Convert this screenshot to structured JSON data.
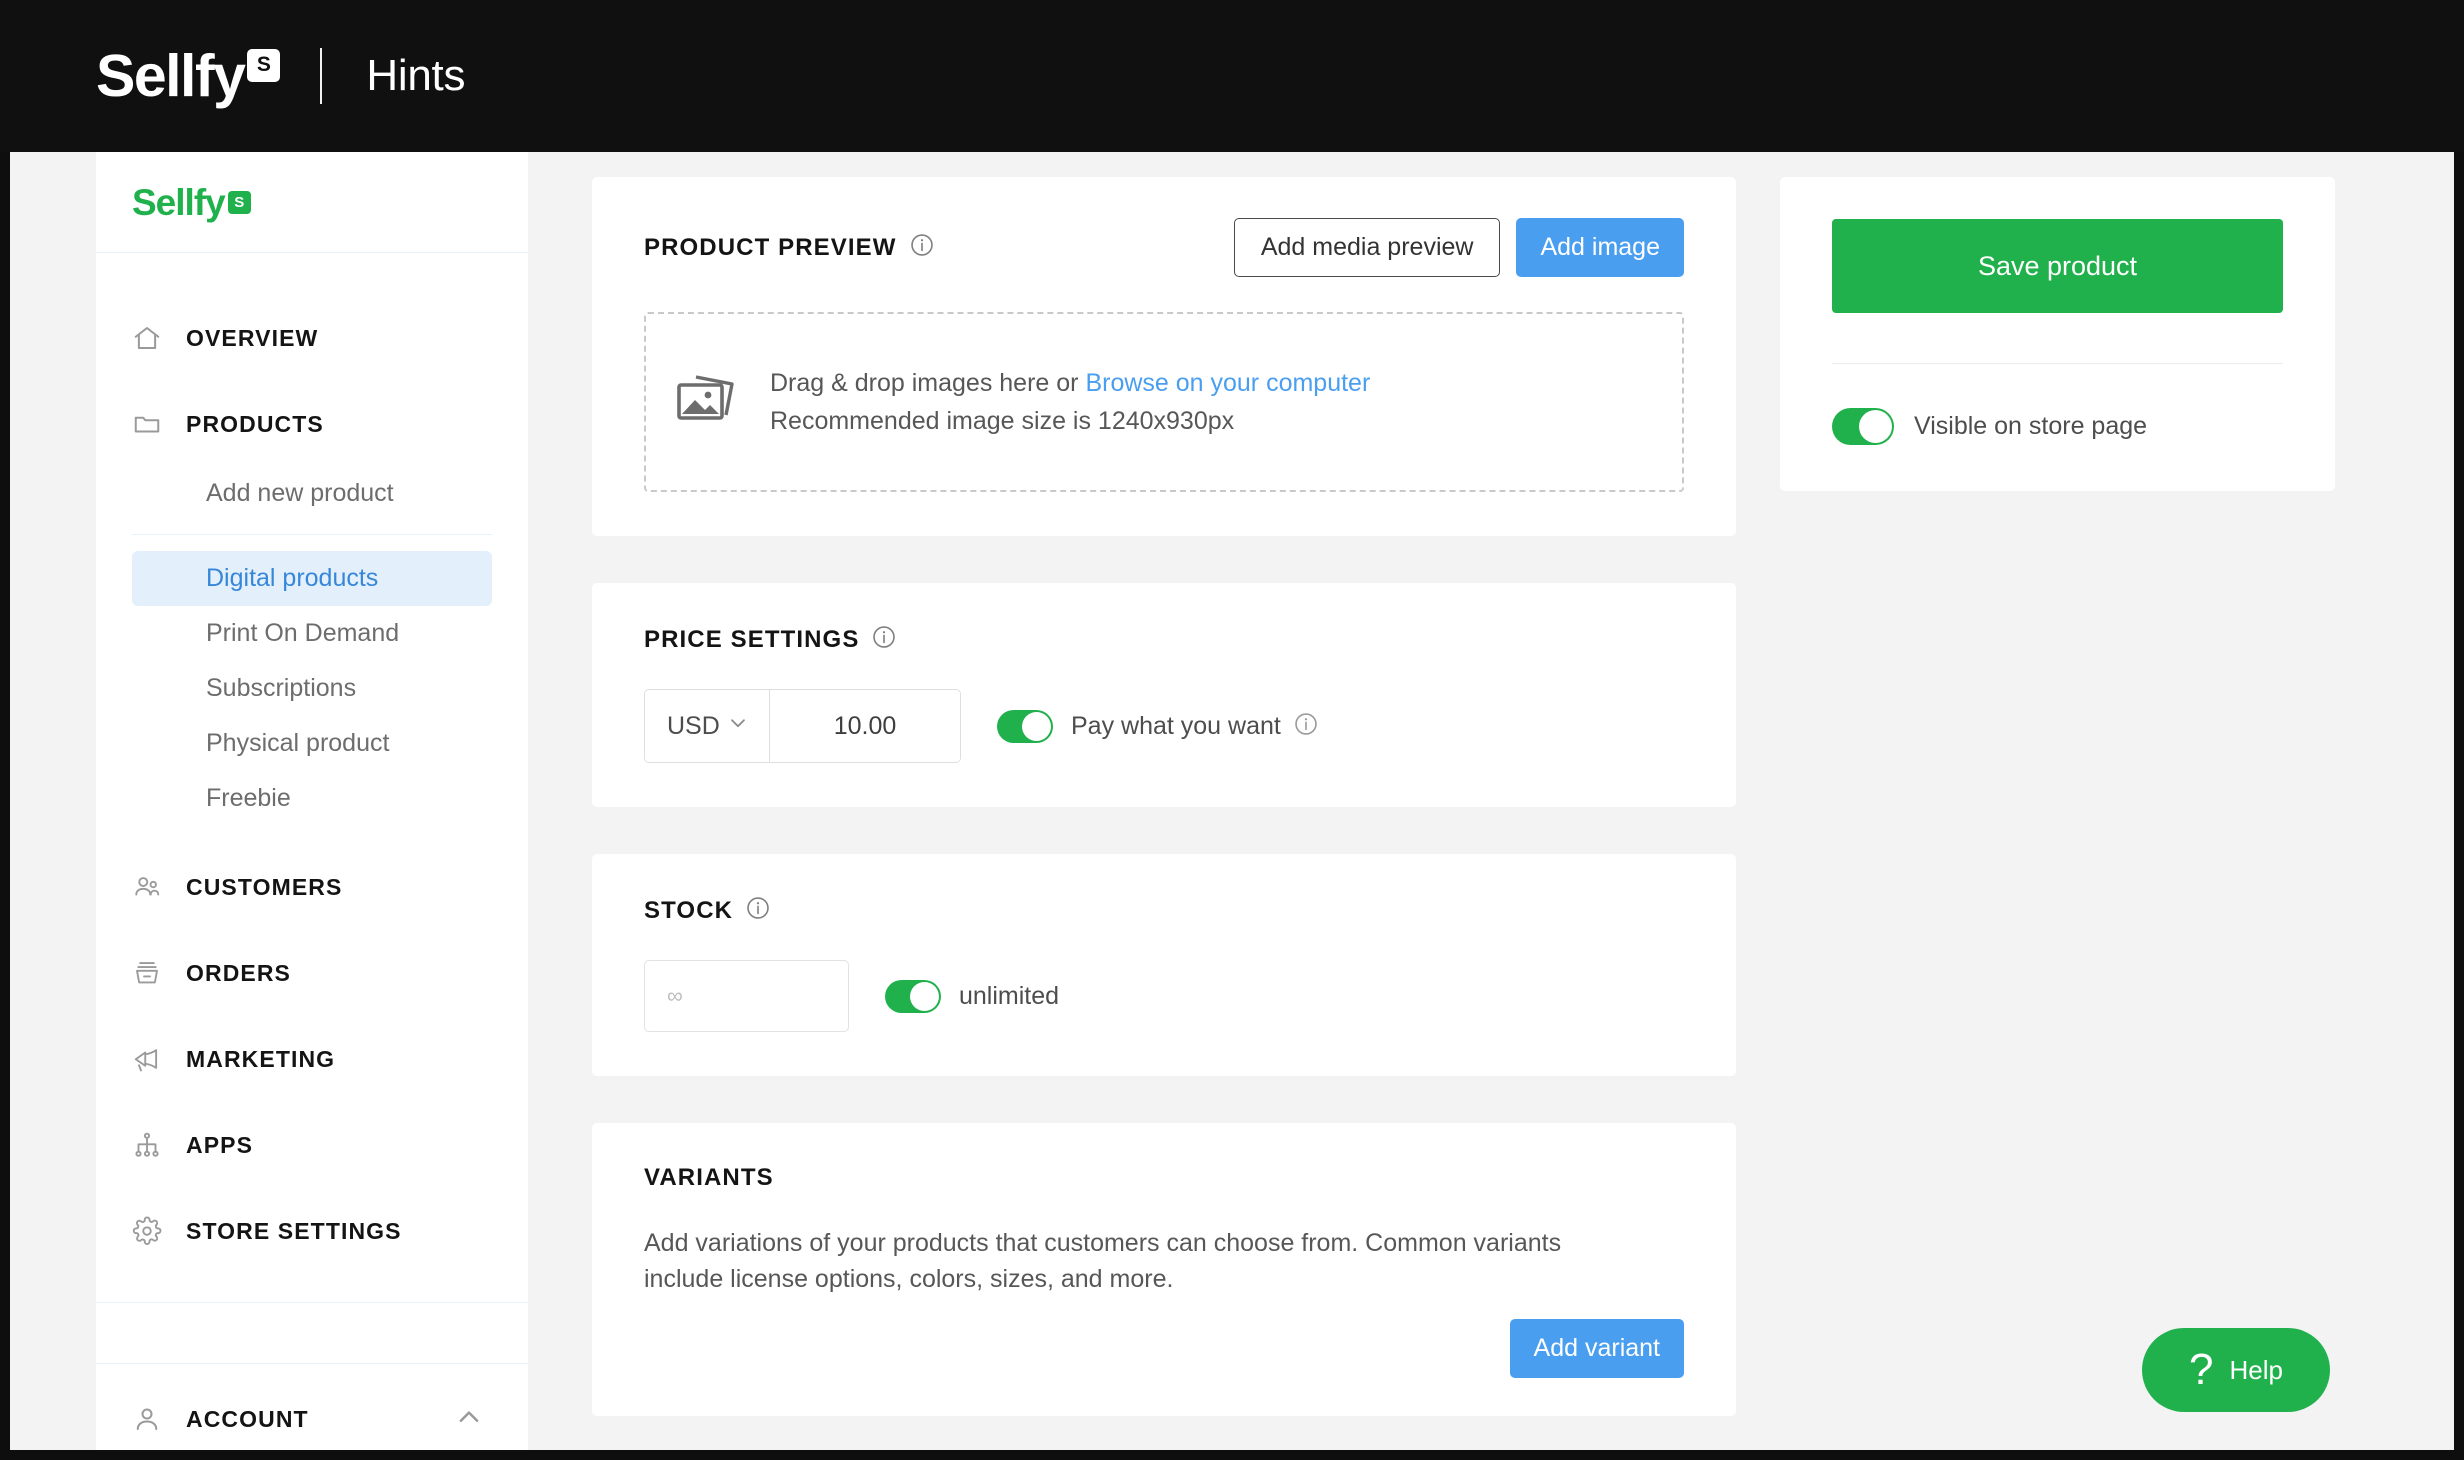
{
  "topbar": {
    "logo_word": "Sellfy",
    "logo_badge": "S",
    "title": "Hints"
  },
  "sidebar": {
    "logo_word": "Sellfy",
    "logo_badge": "S",
    "items": [
      {
        "label": "OVERVIEW",
        "icon": "home-icon"
      },
      {
        "label": "PRODUCTS",
        "icon": "folder-icon"
      },
      {
        "label": "CUSTOMERS",
        "icon": "people-icon"
      },
      {
        "label": "ORDERS",
        "icon": "basket-icon"
      },
      {
        "label": "MARKETING",
        "icon": "megaphone-icon"
      },
      {
        "label": "APPS",
        "icon": "sitemap-icon"
      },
      {
        "label": "STORE SETTINGS",
        "icon": "gear-icon"
      },
      {
        "label": "ACCOUNT",
        "icon": "person-icon"
      }
    ],
    "products_submenu": {
      "add_new": "Add new product",
      "items": [
        {
          "label": "Digital products",
          "active": true
        },
        {
          "label": "Print On Demand",
          "active": false
        },
        {
          "label": "Subscriptions",
          "active": false
        },
        {
          "label": "Physical product",
          "active": false
        },
        {
          "label": "Freebie",
          "active": false
        }
      ]
    }
  },
  "product_preview": {
    "title": "PRODUCT PREVIEW",
    "add_media_preview": "Add media preview",
    "add_image": "Add image",
    "drop_text_before": "Drag & drop images here or ",
    "drop_link": "Browse on your computer",
    "recommended": "Recommended image size is 1240x930px"
  },
  "price_settings": {
    "title": "PRICE SETTINGS",
    "currency": "USD",
    "price": "10.00",
    "pay_what_you_want_label": "Pay what you want",
    "pay_what_you_want_on": true
  },
  "stock": {
    "title": "STOCK",
    "placeholder": "∞",
    "unlimited_label": "unlimited",
    "unlimited_on": true
  },
  "variants": {
    "title": "VARIANTS",
    "description": "Add variations of your products that customers can choose from. Common variants include license options, colors, sizes, and more.",
    "add_variant": "Add variant"
  },
  "right_panel": {
    "save_label": "Save product",
    "visible_label": "Visible on store page",
    "visible_on": true
  },
  "help": {
    "icon": "question-mark-icon",
    "label": "Help"
  },
  "colors": {
    "brand_green": "#21b14c",
    "accent_blue": "#4a9ef0",
    "active_nav_bg": "#e3f0fb",
    "active_nav_text": "#3787d9",
    "topbar_bg": "#101010",
    "page_bg": "#f3f3f3"
  }
}
